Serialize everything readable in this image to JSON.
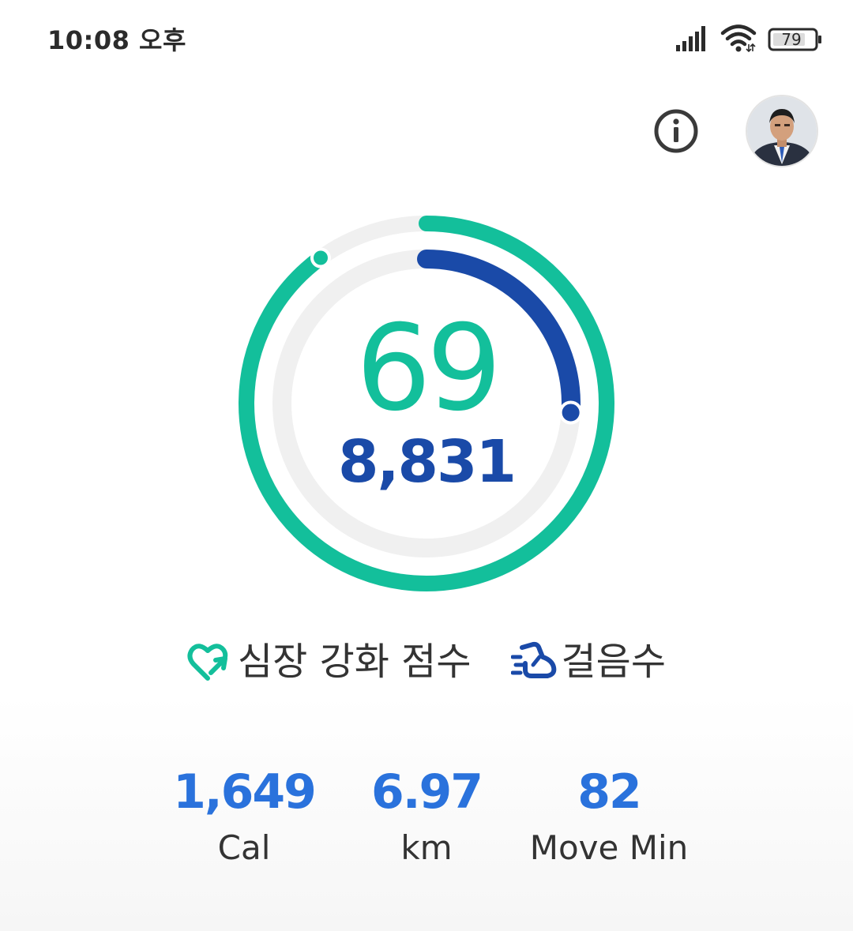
{
  "status_bar": {
    "time": "10:08 오후",
    "battery": "79"
  },
  "summary": {
    "heart_points": "69",
    "steps": "8,831",
    "heart_points_progress": 0.9,
    "steps_progress": 0.26
  },
  "legend": {
    "heart_points_label": "심장 강화 점수",
    "steps_label": "걸음수"
  },
  "stats": [
    {
      "value": "1,649",
      "label": "Cal"
    },
    {
      "value": "6.97",
      "label": "km"
    },
    {
      "value": "82",
      "label": "Move Min"
    }
  ],
  "colors": {
    "heart_points": "#13bf9b",
    "steps": "#1a4aa8",
    "stats": "#2a72dc"
  },
  "icons": {
    "signal": "signal-icon",
    "wifi": "wifi-icon",
    "battery": "battery-icon",
    "info": "info-icon",
    "heart_points": "heart-points-icon",
    "steps": "steps-icon"
  }
}
